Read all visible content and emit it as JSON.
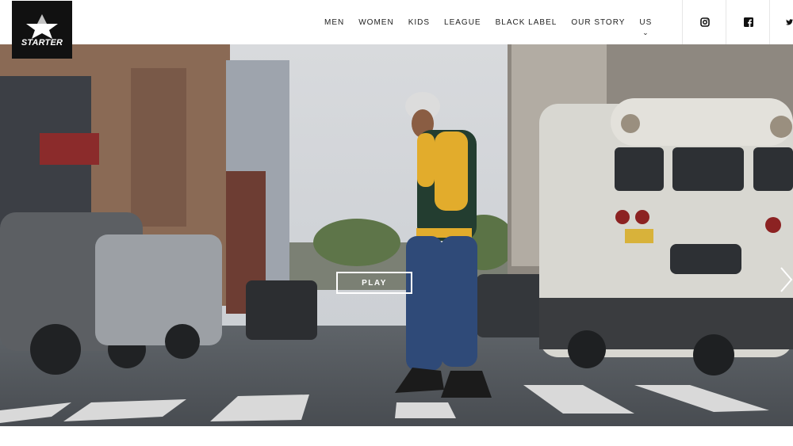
{
  "brand": {
    "logo_text": "STARTER"
  },
  "nav": {
    "items": [
      "MEN",
      "WOMEN",
      "KIDS",
      "LEAGUE",
      "BLACK LABEL",
      "OUR STORY",
      "US"
    ]
  },
  "social": [
    "instagram-icon",
    "facebook-icon",
    "twitter-icon"
  ],
  "hero": {
    "play_label": "PLAY",
    "next_arrow": "chevron-right-icon"
  }
}
